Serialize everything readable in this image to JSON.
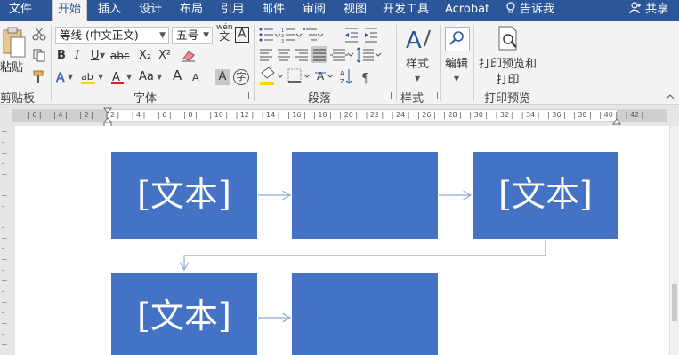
{
  "tabs": [
    {
      "label": "文件",
      "active": false
    },
    {
      "label": "开始",
      "active": true
    },
    {
      "label": "插入",
      "active": false
    },
    {
      "label": "设计",
      "active": false
    },
    {
      "label": "布局",
      "active": false
    },
    {
      "label": "引用",
      "active": false
    },
    {
      "label": "邮件",
      "active": false
    },
    {
      "label": "审阅",
      "active": false
    },
    {
      "label": "视图",
      "active": false
    },
    {
      "label": "开发工具",
      "active": false
    },
    {
      "label": "Acrobat",
      "active": false
    }
  ],
  "tell_me": "告诉我",
  "share": "共享",
  "ribbon": {
    "clipboard": {
      "paste_label": "粘贴",
      "group_label": "剪贴板"
    },
    "font": {
      "font_name": "等线 (中文正文)",
      "font_size": "五号",
      "wen_char": "wén",
      "wen_char2": "文",
      "a_box": "A",
      "bold": "B",
      "italic": "I",
      "underline": "U",
      "strike": "abc",
      "subscript": "X₂",
      "superscript": "X²",
      "aa": "Aa",
      "grow": "A",
      "shrink": "A",
      "a_shade": "A",
      "circled": "字",
      "group_label": "字体"
    },
    "paragraph": {
      "group_label": "段落"
    },
    "styles": {
      "label": "样式",
      "group_label": "样式"
    },
    "editing": {
      "label": "编辑"
    },
    "print_preview": {
      "label_line1": "打印预览和",
      "label_line2": "打印",
      "group_label": "打印预览"
    }
  },
  "ruler_ticks": [
    "6",
    "4",
    "2",
    "2",
    "4",
    "6",
    "8",
    "10",
    "12",
    "14",
    "16",
    "18",
    "20",
    "22",
    "24",
    "26",
    "28",
    "30",
    "32",
    "34",
    "36",
    "38",
    "40",
    "42"
  ],
  "diagram": {
    "boxes": [
      {
        "text": "[文本]"
      },
      {
        "text": ""
      },
      {
        "text": "[文本]"
      },
      {
        "text": "[文本]"
      },
      {
        "text": ""
      }
    ]
  },
  "colors": {
    "accent": "#2b579a",
    "box_fill": "#4472c4",
    "arrow": "#8eaadb"
  }
}
